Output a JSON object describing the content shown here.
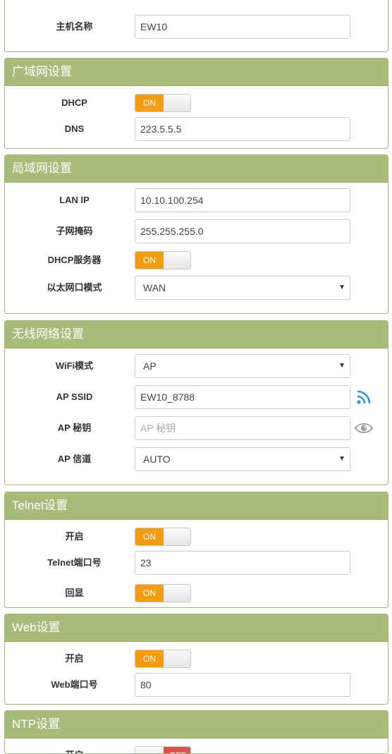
{
  "host": {
    "label": "主机名称",
    "value": "EW10"
  },
  "wan": {
    "title": "广域网设置",
    "dhcp_label": "DHCP",
    "dhcp_state": "ON",
    "dns_label": "DNS",
    "dns_value": "223.5.5.5"
  },
  "lan": {
    "title": "局域网设置",
    "ip_label": "LAN IP",
    "ip_value": "10.10.100.254",
    "mask_label": "子网掩码",
    "mask_value": "255.255.255.0",
    "dhcp_server_label": "DHCP服务器",
    "dhcp_server_state": "ON",
    "eth_mode_label": "以太网口模式",
    "eth_mode_value": "WAN"
  },
  "wireless": {
    "title": "无线网络设置",
    "wifi_mode_label": "WiFi模式",
    "wifi_mode_value": "AP",
    "ssid_label": "AP SSID",
    "ssid_value": "EW10_8788",
    "key_label": "AP 秘钥",
    "key_placeholder": "AP 秘钥",
    "channel_label": "AP 信道",
    "channel_value": "AUTO",
    "icons": [
      "wifi-signal-icon",
      "eye-icon"
    ]
  },
  "telnet": {
    "title": "Telnet设置",
    "enable_label": "开启",
    "enable_state": "ON",
    "port_label": "Telnet端口号",
    "port_value": "23",
    "echo_label": "回显",
    "echo_state": "ON"
  },
  "web": {
    "title": "Web设置",
    "enable_label": "开启",
    "enable_state": "ON",
    "port_label": "Web端口号",
    "port_value": "80"
  },
  "ntp": {
    "title": "NTP设置",
    "enable_label": "开启",
    "enable_state": "OFF"
  },
  "colors": {
    "header": "#a6bc78",
    "toggle_on": "#f39c12",
    "toggle_off": "#d9534f",
    "wifi_icon": "#3a8fd6"
  }
}
